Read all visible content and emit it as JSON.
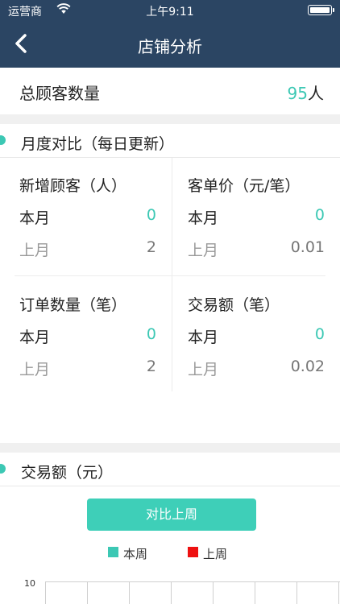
{
  "status_bar": {
    "carrier": "运营商",
    "time": "上午9:11"
  },
  "nav": {
    "title": "店铺分析"
  },
  "total": {
    "label": "总顾客数量",
    "value": "95",
    "unit": "人"
  },
  "monthly": {
    "title": "月度对比（每日更新）",
    "cards": [
      {
        "title": "新增顾客（人）",
        "current_label": "本月",
        "current_value": "0",
        "previous_label": "上月",
        "previous_value": "2"
      },
      {
        "title": "客单价（元/笔）",
        "current_label": "本月",
        "current_value": "0",
        "previous_label": "上月",
        "previous_value": "0.01"
      },
      {
        "title": "订单数量（笔）",
        "current_label": "本月",
        "current_value": "0",
        "previous_label": "上月",
        "previous_value": "2"
      },
      {
        "title": "交易额（笔）",
        "current_label": "本月",
        "current_value": "0",
        "previous_label": "上月",
        "previous_value": "0.02"
      }
    ]
  },
  "trade": {
    "title": "交易额（元）",
    "compare_button": "对比上周",
    "legend": [
      {
        "label": "本周",
        "color": "#3cc8b4"
      },
      {
        "label": "上周",
        "color": "#ee1111"
      }
    ],
    "y_tick": "10"
  },
  "icons": {
    "back": "chevron-left-icon",
    "wifi": "wifi-icon",
    "battery": "battery-icon"
  },
  "colors": {
    "nav_bg": "#2b4563",
    "accent": "#3cc8b4",
    "last_week": "#ee1111"
  }
}
